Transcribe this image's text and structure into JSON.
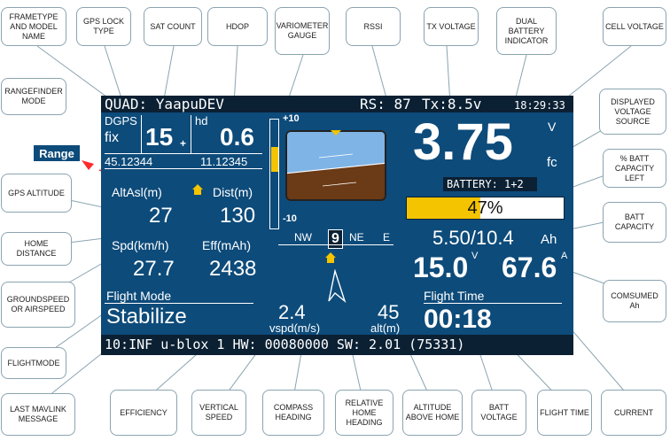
{
  "osd": {
    "frame": "QUAD: YaapuDEV",
    "rssi": "RS: 87",
    "tx": "Tx:8.5v",
    "time": "18:29:33",
    "gps_type": "DGPS",
    "gps_fix": "fix",
    "sats": "15",
    "sats_suffix": "+",
    "hdop_label": "hd",
    "hdop": "0.6",
    "lat": "45.12344",
    "lon": "11.12345",
    "vario_top": "+10",
    "vario_bottom": "-10",
    "cell_voltage": "3.75",
    "volt_unit": "V",
    "volt_source": "fc",
    "battery": "BATTERY: 1+2",
    "batt_pct": "47%",
    "batt_pct_value": 0.47,
    "capacity": "5.50/10.4",
    "capacity_unit": "Ah",
    "alt_label": "AltAsl(m)",
    "alt": "27",
    "dist_label": "Dist(m)",
    "dist": "130",
    "spd_label": "Spd(km/h)",
    "spd": "27.7",
    "eff_label": "Eff(mAh)",
    "eff": "2438",
    "compass_nw": "NW",
    "compass_heading": "9",
    "compass_ne": "NE",
    "compass_e": "E",
    "batt_voltage": "15.0",
    "batt_voltage_unit": "V",
    "current": "67.6",
    "current_unit": "A",
    "flight_mode_label": "Flight Mode",
    "flight_mode": "Stabilize",
    "vspd": "2.4",
    "vspd_label": "vspd(m/s)",
    "home_alt": "45",
    "home_alt_label": "alt(m)",
    "flight_time_label": "Flight Time",
    "flight_time": "00:18",
    "message": "10:INF u-blox 1 HW: 00080000 SW: 2.01 (75331)",
    "range": "Range",
    "colors": {
      "screen": "#0d4b7a",
      "bars": "#0b2033",
      "accent": "#f5c400",
      "sky": "#7fb4e6",
      "ground": "#6b3a16"
    }
  },
  "callouts": {
    "frametype": "FRAMETYPE AND MODEL NAME",
    "gpslock": "GPS LOCK TYPE",
    "satcount": "SAT COUNT",
    "hdop": "HDOP",
    "vario": "VARIOMETER GAUGE",
    "rssi": "RSSI",
    "txvolt": "TX VOLTAGE",
    "dualbatt": "DUAL BATTERY INDICATOR",
    "cellvolt": "CELL VOLTAGE",
    "rangefinder": "RANGEFINDER MODE",
    "dispvolt": "DISPLAYED VOLTAGE SOURCE",
    "pctbatt": "% BATT CAPACITY LEFT",
    "gpsalt": "GPS ALTITUDE",
    "battcap": "BATT CAPACITY",
    "homedist": "HOME DISTANCE",
    "groundspeed": "GROUNDSPEED OR AIRSPEED",
    "consumed": "COMSUMED Ah",
    "flightmode": "FLIGHTMODE",
    "lastmav": "LAST MAVLINK MESSAGE",
    "efficiency": "EFFICIENCY",
    "vspeed": "VERTICAL SPEED",
    "compass": "COMPASS HEADING",
    "relhome": "RELATIVE HOME HEADING",
    "althome": "ALTITUDE ABOVE HOME",
    "battvolt": "BATT VOLTAGE",
    "flighttime": "FLIGHT TIME",
    "current": "CURRENT"
  }
}
